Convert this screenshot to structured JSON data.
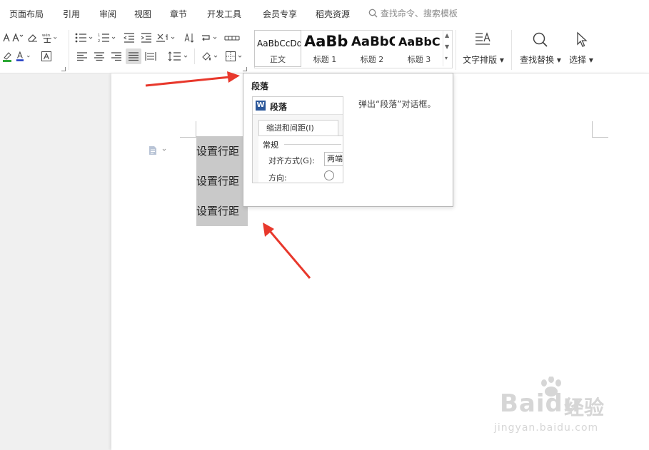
{
  "menu": {
    "items": [
      "页面布局",
      "引用",
      "审阅",
      "视图",
      "章节",
      "开发工具",
      "会员专享",
      "稻壳资源"
    ],
    "search_placeholder": "查找命令、搜索模板"
  },
  "ribbon": {
    "styles": [
      {
        "sample": "AaBbCcDd",
        "name": "正文"
      },
      {
        "sample": "AaBb",
        "name": "标题 1"
      },
      {
        "sample": "AaBbC",
        "name": "标题 2"
      },
      {
        "sample": "AaBbC",
        "name": "标题 3"
      }
    ],
    "text_layout_label": "文字排版",
    "find_replace_label": "查找替换",
    "select_label": "选择"
  },
  "document": {
    "lines": [
      "设置行距",
      "设置行距",
      "设置行距"
    ]
  },
  "tooltip": {
    "title": "段落",
    "description": "弹出“段落”对话框。",
    "dialog": {
      "title": "段落",
      "tab": "缩进和间距(I)",
      "group": "常规",
      "align_label": "对齐方式(G):",
      "align_value": "两端对齐",
      "direction_label": "方向:"
    }
  },
  "watermark": {
    "brand": "Baidu",
    "brand_cn": "经验",
    "url": "jingyan.baidu.com"
  },
  "colors": {
    "arrow": "#e8382c",
    "selection": "#c9c9c9",
    "wps_blue": "#2b579a"
  }
}
